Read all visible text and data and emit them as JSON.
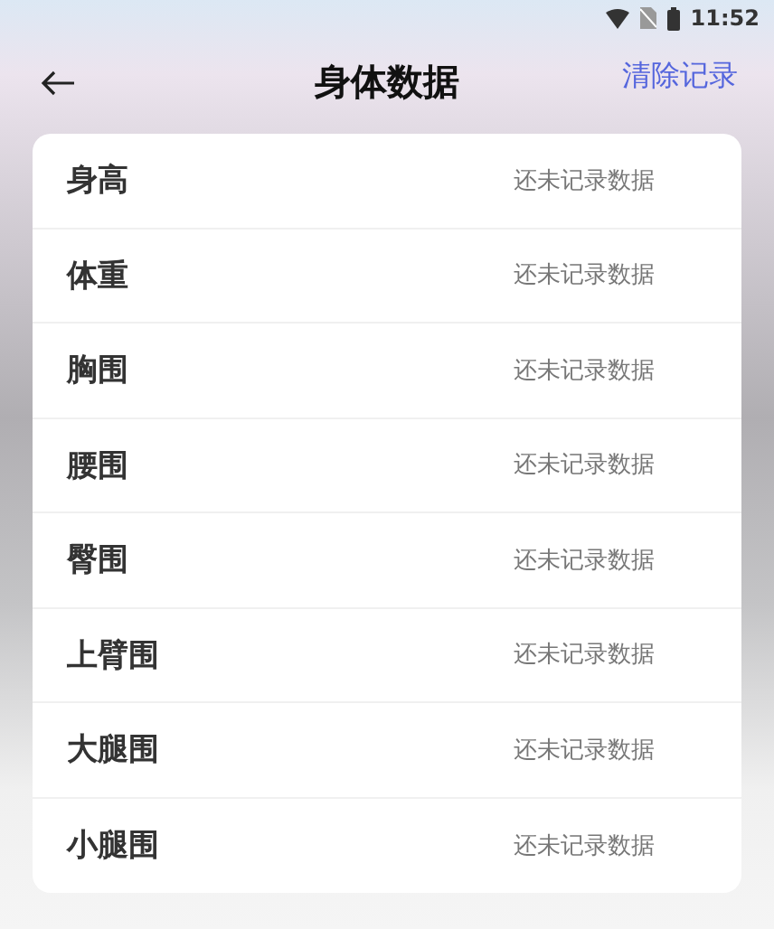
{
  "status_bar": {
    "time": "11:52"
  },
  "header": {
    "title": "身体数据",
    "action": "清除记录"
  },
  "rows": [
    {
      "label": "身高",
      "value": "还未记录数据"
    },
    {
      "label": "体重",
      "value": "还未记录数据"
    },
    {
      "label": "胸围",
      "value": "还未记录数据"
    },
    {
      "label": "腰围",
      "value": "还未记录数据"
    },
    {
      "label": "臀围",
      "value": "还未记录数据"
    },
    {
      "label": "上臂围",
      "value": "还未记录数据"
    },
    {
      "label": "大腿围",
      "value": "还未记录数据"
    },
    {
      "label": "小腿围",
      "value": "还未记录数据"
    }
  ]
}
